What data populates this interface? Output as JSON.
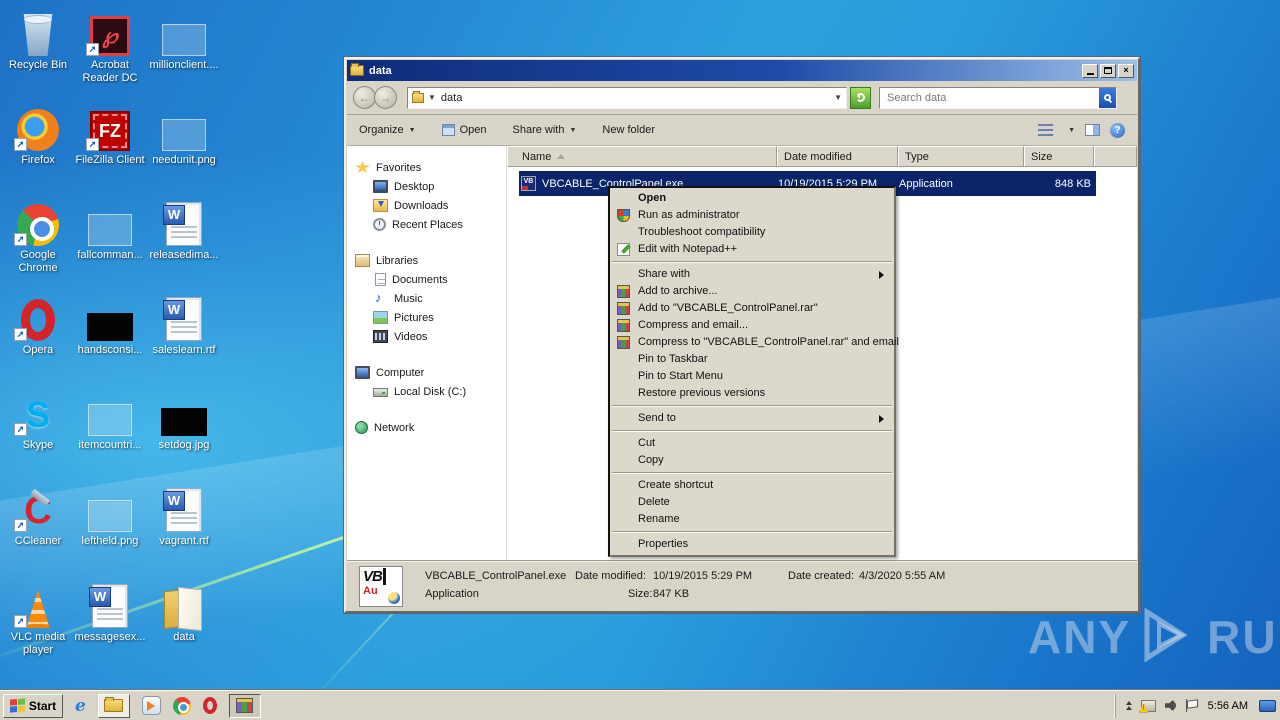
{
  "desktop": {
    "icons": [
      {
        "label": "Recycle Bin",
        "icon": "recycle-bin"
      },
      {
        "label": "Acrobat Reader DC",
        "icon": "acrobat-reader"
      },
      {
        "label": "millionclient....",
        "icon": "image-placeholder"
      },
      {
        "label": "Firefox",
        "icon": "firefox"
      },
      {
        "label": "FileZilla Client",
        "icon": "filezilla"
      },
      {
        "label": "needunit.png",
        "icon": "image-placeholder"
      },
      {
        "label": "Google Chrome",
        "icon": "chrome"
      },
      {
        "label": "fallcomman...",
        "icon": "image-placeholder"
      },
      {
        "label": "releasedima...",
        "icon": "word-document"
      },
      {
        "label": "Opera",
        "icon": "opera"
      },
      {
        "label": "handsconsi...",
        "icon": "image-black-thumb"
      },
      {
        "label": "saleslearn.rtf",
        "icon": "word-document"
      },
      {
        "label": "Skype",
        "icon": "skype"
      },
      {
        "label": "itemcountri...",
        "icon": "image-placeholder"
      },
      {
        "label": "setdog.jpg",
        "icon": "image-black-thumb"
      },
      {
        "label": "CCleaner",
        "icon": "ccleaner"
      },
      {
        "label": "leftheld.png",
        "icon": "image-placeholder"
      },
      {
        "label": "vagrant.rtf",
        "icon": "word-document"
      },
      {
        "label": "VLC media player",
        "icon": "vlc"
      },
      {
        "label": "messagesex...",
        "icon": "word-document"
      },
      {
        "label": "data",
        "icon": "open-folder"
      }
    ]
  },
  "window": {
    "title": "data",
    "address_path": "data",
    "search_placeholder": "Search data",
    "toolbar": {
      "organize": "Organize",
      "open": "Open",
      "share_with": "Share with",
      "new_folder": "New folder"
    },
    "nav": {
      "sections": [
        {
          "label": "Favorites",
          "icon": "star",
          "items": [
            {
              "label": "Desktop",
              "icon": "desktop"
            },
            {
              "label": "Downloads",
              "icon": "downloads-folder"
            },
            {
              "label": "Recent Places",
              "icon": "recent-places"
            }
          ]
        },
        {
          "label": "Libraries",
          "icon": "libraries-folder",
          "items": [
            {
              "label": "Documents",
              "icon": "document"
            },
            {
              "label": "Music",
              "icon": "music-note"
            },
            {
              "label": "Pictures",
              "icon": "picture"
            },
            {
              "label": "Videos",
              "icon": "film"
            }
          ]
        },
        {
          "label": "Computer",
          "icon": "computer-monitor",
          "items": [
            {
              "label": "Local Disk (C:)",
              "icon": "hard-disk"
            }
          ]
        },
        {
          "label": "Network",
          "icon": "network-globe",
          "items": []
        }
      ]
    },
    "file_list": {
      "columns": [
        "Name",
        "Date modified",
        "Type",
        "Size"
      ],
      "rows": [
        {
          "name": "VBCABLE_ControlPanel.exe",
          "date_modified": "10/19/2015 5:29 PM",
          "type": "Application",
          "size": "848 KB"
        }
      ]
    },
    "details_pane": {
      "file_name": "VBCABLE_ControlPanel.exe",
      "file_type": "Application",
      "date_modified_label": "Date modified:",
      "date_modified": "10/19/2015 5:29 PM",
      "size_label": "Size:",
      "size": "847 KB",
      "date_created_label": "Date created:",
      "date_created": "4/3/2020 5:55 AM"
    }
  },
  "context_menu": {
    "groups": [
      {
        "items": [
          {
            "label": "Open",
            "icon": "none",
            "default_bold": true
          },
          {
            "label": "Run as administrator",
            "icon": "uac-shield"
          },
          {
            "label": "Troubleshoot compatibility",
            "icon": "none"
          },
          {
            "label": "Edit with Notepad++",
            "icon": "notepad-plus-plus"
          }
        ]
      },
      {
        "items": [
          {
            "label": "Share with",
            "icon": "none",
            "submenu": true
          },
          {
            "label": "Add to archive...",
            "icon": "winrar"
          },
          {
            "label": "Add to \"VBCABLE_ControlPanel.rar\"",
            "icon": "winrar"
          },
          {
            "label": "Compress and email...",
            "icon": "winrar"
          },
          {
            "label": "Compress to \"VBCABLE_ControlPanel.rar\" and email",
            "icon": "winrar"
          },
          {
            "label": "Pin to Taskbar",
            "icon": "none"
          },
          {
            "label": "Pin to Start Menu",
            "icon": "none"
          },
          {
            "label": "Restore previous versions",
            "icon": "none"
          }
        ]
      },
      {
        "items": [
          {
            "label": "Send to",
            "icon": "none",
            "submenu": true
          }
        ]
      },
      {
        "items": [
          {
            "label": "Cut",
            "icon": "none"
          },
          {
            "label": "Copy",
            "icon": "none"
          }
        ]
      },
      {
        "items": [
          {
            "label": "Create shortcut",
            "icon": "none"
          },
          {
            "label": "Delete",
            "icon": "none"
          },
          {
            "label": "Rename",
            "icon": "none"
          }
        ]
      },
      {
        "items": [
          {
            "label": "Properties",
            "icon": "none"
          }
        ]
      }
    ]
  },
  "taskbar": {
    "start_label": "Start",
    "quick_launch": [
      "internet-explorer",
      "windows-explorer",
      "windows-media-player",
      "chrome",
      "opera",
      "winrar"
    ],
    "tray_time": "5:56 AM"
  },
  "watermark": {
    "left": "ANY",
    "right": "RUN"
  },
  "colors": {
    "selection": "#0a246a",
    "titlebar_left": "#0f2b7a",
    "titlebar_right": "#9cc0ea",
    "classic_face": "#d8d4c8",
    "search_button": "#1a4fae",
    "refresh_button": "#4d9e2c"
  }
}
